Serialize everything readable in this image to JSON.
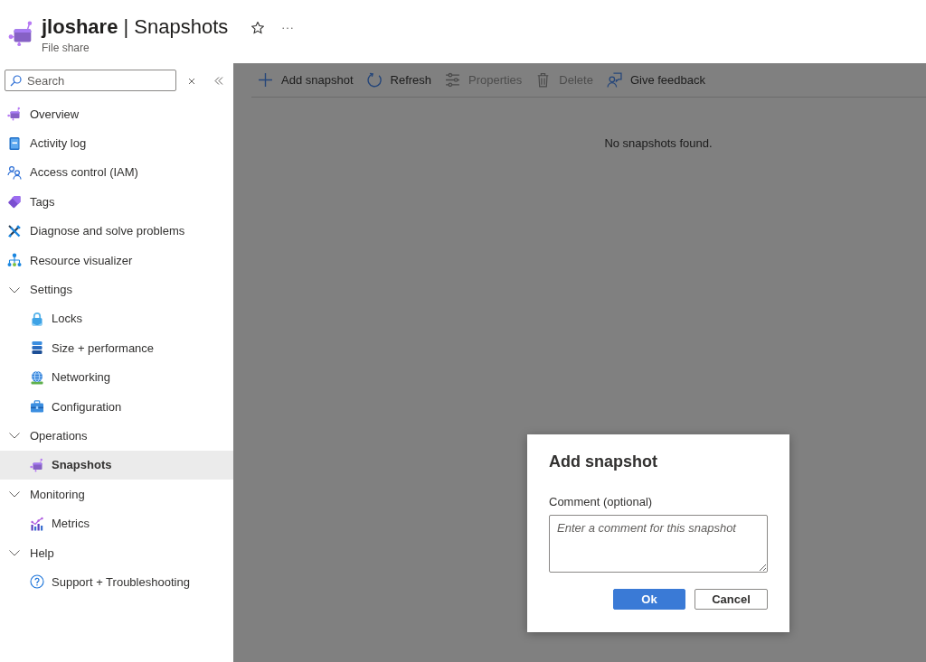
{
  "header": {
    "title": "**jloshare** | Snapshots",
    "subtitle": "File share"
  },
  "sidebar": {
    "search": {
      "placeholder": "Search"
    },
    "items": [
      {
        "kind": "link",
        "label": "Overview",
        "selected": false
      },
      {
        "kind": "link",
        "label": "Activity log",
        "selected": false
      },
      {
        "kind": "link",
        "label": "Access control (IAM)",
        "selected": false
      },
      {
        "kind": "link",
        "label": "Tags",
        "selected": false
      },
      {
        "kind": "link",
        "label": "Diagnose and solve problems",
        "selected": false
      },
      {
        "kind": "link",
        "label": "Resource visualizer",
        "selected": false
      },
      {
        "kind": "group",
        "label": "Settings",
        "selected": false,
        "expanded": true,
        "children": [
          {
            "label": "Locks",
            "selected": false
          },
          {
            "label": "Size + performance",
            "selected": false
          },
          {
            "label": "Networking",
            "selected": false
          },
          {
            "label": "Configuration",
            "selected": false
          }
        ]
      },
      {
        "kind": "group",
        "label": "Operations",
        "selected": false,
        "expanded": true,
        "children": [
          {
            "label": "Snapshots",
            "selected": true
          }
        ]
      },
      {
        "kind": "group",
        "label": "Monitoring",
        "selected": false,
        "expanded": true,
        "children": [
          {
            "label": "Metrics",
            "selected": false
          }
        ]
      },
      {
        "kind": "group",
        "label": "Help",
        "selected": false,
        "expanded": true,
        "children": [
          {
            "label": "Support + Troubleshooting",
            "selected": false
          }
        ]
      }
    ]
  },
  "toolbar": {
    "buttons": [
      {
        "label": "Add snapshot",
        "disabled": false
      },
      {
        "label": "Refresh",
        "disabled": false
      },
      {
        "label": "Properties",
        "disabled": true
      },
      {
        "label": "Delete",
        "disabled": true
      },
      {
        "label": "Give feedback",
        "disabled": false
      }
    ]
  },
  "content": {
    "message": "No snapshots found."
  },
  "dialog": {
    "title": "Add snapshot",
    "field_label": "Comment (optional)",
    "placeholder": "Enter a comment for this snapshot",
    "buttons": [
      {
        "label": "Ok",
        "kind": "primary"
      },
      {
        "label": "Cancel",
        "kind": "secondary"
      }
    ]
  }
}
